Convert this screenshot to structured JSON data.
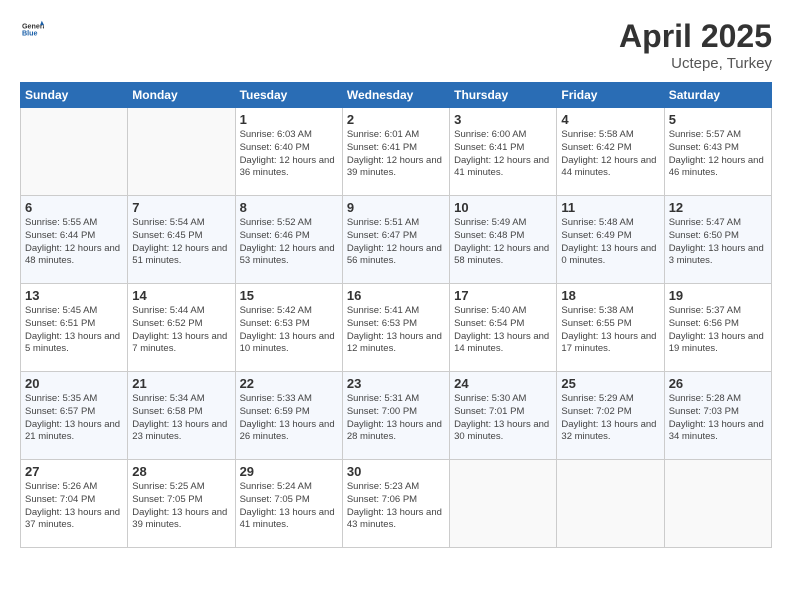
{
  "header": {
    "logo_general": "General",
    "logo_blue": "Blue",
    "month": "April 2025",
    "location": "Uctepe, Turkey"
  },
  "weekdays": [
    "Sunday",
    "Monday",
    "Tuesday",
    "Wednesday",
    "Thursday",
    "Friday",
    "Saturday"
  ],
  "weeks": [
    [
      {
        "day": "",
        "info": ""
      },
      {
        "day": "",
        "info": ""
      },
      {
        "day": "1",
        "info": "Sunrise: 6:03 AM\nSunset: 6:40 PM\nDaylight: 12 hours\nand 36 minutes."
      },
      {
        "day": "2",
        "info": "Sunrise: 6:01 AM\nSunset: 6:41 PM\nDaylight: 12 hours\nand 39 minutes."
      },
      {
        "day": "3",
        "info": "Sunrise: 6:00 AM\nSunset: 6:41 PM\nDaylight: 12 hours\nand 41 minutes."
      },
      {
        "day": "4",
        "info": "Sunrise: 5:58 AM\nSunset: 6:42 PM\nDaylight: 12 hours\nand 44 minutes."
      },
      {
        "day": "5",
        "info": "Sunrise: 5:57 AM\nSunset: 6:43 PM\nDaylight: 12 hours\nand 46 minutes."
      }
    ],
    [
      {
        "day": "6",
        "info": "Sunrise: 5:55 AM\nSunset: 6:44 PM\nDaylight: 12 hours\nand 48 minutes."
      },
      {
        "day": "7",
        "info": "Sunrise: 5:54 AM\nSunset: 6:45 PM\nDaylight: 12 hours\nand 51 minutes."
      },
      {
        "day": "8",
        "info": "Sunrise: 5:52 AM\nSunset: 6:46 PM\nDaylight: 12 hours\nand 53 minutes."
      },
      {
        "day": "9",
        "info": "Sunrise: 5:51 AM\nSunset: 6:47 PM\nDaylight: 12 hours\nand 56 minutes."
      },
      {
        "day": "10",
        "info": "Sunrise: 5:49 AM\nSunset: 6:48 PM\nDaylight: 12 hours\nand 58 minutes."
      },
      {
        "day": "11",
        "info": "Sunrise: 5:48 AM\nSunset: 6:49 PM\nDaylight: 13 hours\nand 0 minutes."
      },
      {
        "day": "12",
        "info": "Sunrise: 5:47 AM\nSunset: 6:50 PM\nDaylight: 13 hours\nand 3 minutes."
      }
    ],
    [
      {
        "day": "13",
        "info": "Sunrise: 5:45 AM\nSunset: 6:51 PM\nDaylight: 13 hours\nand 5 minutes."
      },
      {
        "day": "14",
        "info": "Sunrise: 5:44 AM\nSunset: 6:52 PM\nDaylight: 13 hours\nand 7 minutes."
      },
      {
        "day": "15",
        "info": "Sunrise: 5:42 AM\nSunset: 6:53 PM\nDaylight: 13 hours\nand 10 minutes."
      },
      {
        "day": "16",
        "info": "Sunrise: 5:41 AM\nSunset: 6:53 PM\nDaylight: 13 hours\nand 12 minutes."
      },
      {
        "day": "17",
        "info": "Sunrise: 5:40 AM\nSunset: 6:54 PM\nDaylight: 13 hours\nand 14 minutes."
      },
      {
        "day": "18",
        "info": "Sunrise: 5:38 AM\nSunset: 6:55 PM\nDaylight: 13 hours\nand 17 minutes."
      },
      {
        "day": "19",
        "info": "Sunrise: 5:37 AM\nSunset: 6:56 PM\nDaylight: 13 hours\nand 19 minutes."
      }
    ],
    [
      {
        "day": "20",
        "info": "Sunrise: 5:35 AM\nSunset: 6:57 PM\nDaylight: 13 hours\nand 21 minutes."
      },
      {
        "day": "21",
        "info": "Sunrise: 5:34 AM\nSunset: 6:58 PM\nDaylight: 13 hours\nand 23 minutes."
      },
      {
        "day": "22",
        "info": "Sunrise: 5:33 AM\nSunset: 6:59 PM\nDaylight: 13 hours\nand 26 minutes."
      },
      {
        "day": "23",
        "info": "Sunrise: 5:31 AM\nSunset: 7:00 PM\nDaylight: 13 hours\nand 28 minutes."
      },
      {
        "day": "24",
        "info": "Sunrise: 5:30 AM\nSunset: 7:01 PM\nDaylight: 13 hours\nand 30 minutes."
      },
      {
        "day": "25",
        "info": "Sunrise: 5:29 AM\nSunset: 7:02 PM\nDaylight: 13 hours\nand 32 minutes."
      },
      {
        "day": "26",
        "info": "Sunrise: 5:28 AM\nSunset: 7:03 PM\nDaylight: 13 hours\nand 34 minutes."
      }
    ],
    [
      {
        "day": "27",
        "info": "Sunrise: 5:26 AM\nSunset: 7:04 PM\nDaylight: 13 hours\nand 37 minutes."
      },
      {
        "day": "28",
        "info": "Sunrise: 5:25 AM\nSunset: 7:05 PM\nDaylight: 13 hours\nand 39 minutes."
      },
      {
        "day": "29",
        "info": "Sunrise: 5:24 AM\nSunset: 7:05 PM\nDaylight: 13 hours\nand 41 minutes."
      },
      {
        "day": "30",
        "info": "Sunrise: 5:23 AM\nSunset: 7:06 PM\nDaylight: 13 hours\nand 43 minutes."
      },
      {
        "day": "",
        "info": ""
      },
      {
        "day": "",
        "info": ""
      },
      {
        "day": "",
        "info": ""
      }
    ]
  ]
}
